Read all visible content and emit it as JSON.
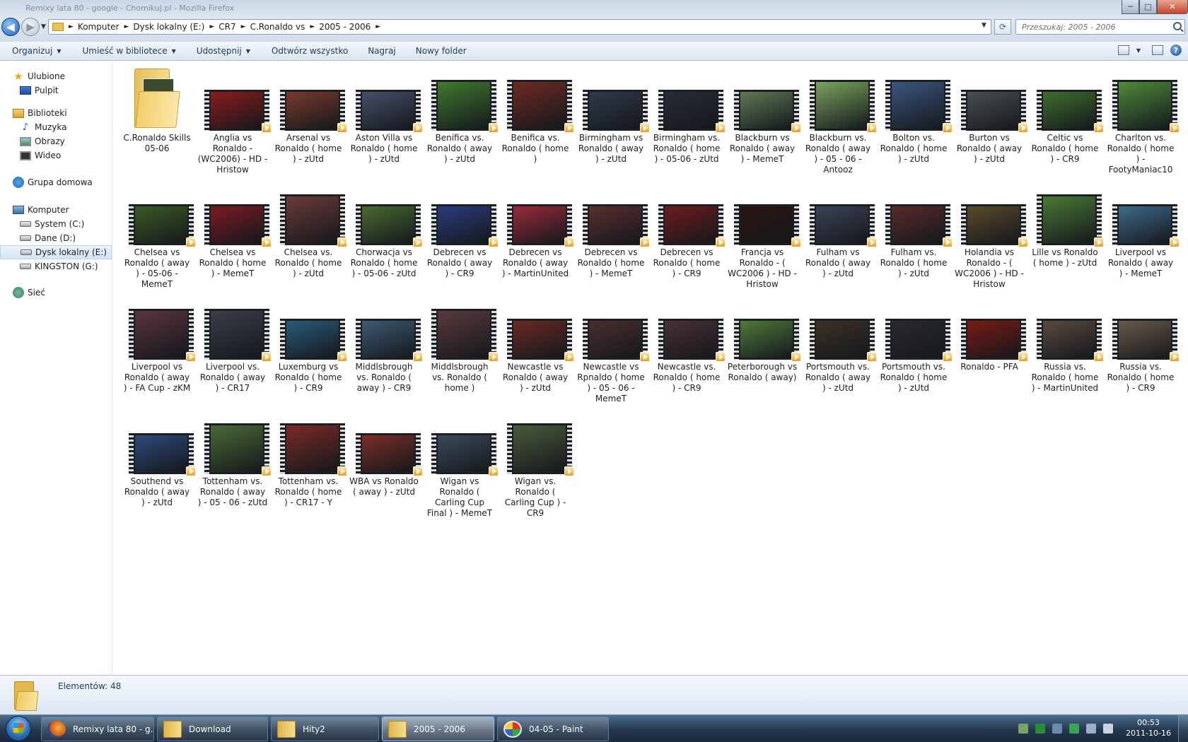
{
  "window": {
    "title_ghost": "Remixy lata 80 - google - Chomikuj.pl - Mozilla Firefox",
    "controls": {
      "minimize": "─",
      "maximize": "□",
      "close": "✕"
    }
  },
  "nav": {
    "back_icon": "◀",
    "forward_icon": "▶",
    "history_dropdown": "▼"
  },
  "address": {
    "crumbs": [
      "Komputer",
      "Dysk lokalny (E:)",
      "CR7",
      "C.Ronaldo vs",
      "2005 - 2006"
    ],
    "separator": "►",
    "dropdown": "▼",
    "refresh_icon": "⟳"
  },
  "search": {
    "placeholder": "Przeszukaj: 2005 - 2006"
  },
  "toolbar": {
    "items": [
      {
        "label": "Organizuj",
        "has_menu": true
      },
      {
        "label": "Umieść w bibliotece",
        "has_menu": true
      },
      {
        "label": "Udostępnij",
        "has_menu": true
      },
      {
        "label": "Odtwórz wszystko",
        "has_menu": false
      },
      {
        "label": "Nagraj",
        "has_menu": false
      },
      {
        "label": "Nowy folder",
        "has_menu": false
      }
    ],
    "caret": "▼",
    "view_caret": "▼",
    "help": "?"
  },
  "sidebar": {
    "groups": [
      {
        "label": "Ulubione",
        "icon": "star-icon",
        "children": [
          {
            "label": "Pulpit",
            "icon": "desktop-icon"
          }
        ]
      },
      {
        "label": "Biblioteki",
        "icon": "library-icon",
        "children": [
          {
            "label": "Muzyka",
            "icon": "music-icon"
          },
          {
            "label": "Obrazy",
            "icon": "pictures-icon"
          },
          {
            "label": "Wideo",
            "icon": "video-icon"
          }
        ]
      },
      {
        "label": "Grupa domowa",
        "icon": "homegroup-icon",
        "children": []
      },
      {
        "label": "Komputer",
        "icon": "computer-icon",
        "children": [
          {
            "label": "System (C:)",
            "icon": "drive-icon"
          },
          {
            "label": "Dane (D:)",
            "icon": "drive-icon"
          },
          {
            "label": "Dysk lokalny (E:)",
            "icon": "drive-icon",
            "selected": true
          },
          {
            "label": "KINGSTON (G:)",
            "icon": "usb-drive-icon"
          }
        ]
      },
      {
        "label": "Sieć",
        "icon": "network-icon",
        "children": []
      }
    ],
    "star_glyph": "★",
    "music_glyph": "♪"
  },
  "files": [
    {
      "name": "C.Ronaldo Skills 05-06",
      "type": "folder"
    },
    {
      "name": "Anglia vs Ronaldo - (WC2006) - HD - Hristow",
      "type": "video",
      "color": "#8a1c1c"
    },
    {
      "name": "Arsenal vs Ronaldo ( home ) - zUtd",
      "type": "video",
      "color": "#7a3a2c"
    },
    {
      "name": "Aston Villa vs Ronaldo ( home ) - zUtd",
      "type": "video",
      "color": "#45506a"
    },
    {
      "name": "Benifica vs. Ronaldo ( away ) - zUtd",
      "type": "video",
      "color": "#3f7a2e",
      "tall": true
    },
    {
      "name": "Benifica vs. Ronaldo ( home )",
      "type": "video",
      "color": "#6e2a22",
      "tall": true
    },
    {
      "name": "Birmingham vs Ronaldo ( away ) - zUtd",
      "type": "video",
      "color": "#2f3a4a"
    },
    {
      "name": "Birmingham vs. Ronaldo ( home ) - 05-06 - zUtd",
      "type": "video",
      "color": "#262d38"
    },
    {
      "name": "Blackburn vs Ronaldo ( away ) -  MemeT",
      "type": "video",
      "color": "#5d7a52"
    },
    {
      "name": "Blackburn vs. Ronaldo ( away ) - 05 - 06 - Antooz",
      "type": "video",
      "color": "#7aa35e",
      "tall": true
    },
    {
      "name": "Bolton vs. Ronaldo ( home ) - zUtd",
      "type": "video",
      "color": "#3a567e",
      "tall": true
    },
    {
      "name": "Burton vs Ronaldo ( away ) - zUtd",
      "type": "video",
      "color": "#4a4e52"
    },
    {
      "name": "Celtic vs Ronaldo ( home  ) - CR9",
      "type": "video",
      "color": "#3e6e2c"
    },
    {
      "name": "Charlton vs. Ronaldo ( home ) - FootyManiac10",
      "type": "video",
      "color": "#4f8a3a",
      "tall": true
    },
    {
      "name": "Chelsea vs Ronaldo ( away ) - 05-06 - MemeT",
      "type": "video",
      "color": "#3c5a26"
    },
    {
      "name": "Chelsea vs Ronaldo ( home ) - MemeT",
      "type": "video",
      "color": "#7a1a22"
    },
    {
      "name": "Chelsea vs. Ronaldo ( home ) - zUtd",
      "type": "video",
      "color": "#6b3a38",
      "tall": true
    },
    {
      "name": "Chorwacja vs Ronaldo ( home ) - 05-06 - zUtd",
      "type": "video",
      "color": "#4a6a30"
    },
    {
      "name": "Debrecen vs Ronaldo ( away ) - CR9",
      "type": "video",
      "color": "#2a3c7e"
    },
    {
      "name": "Debrecen vs Ronaldo ( away ) - MartinUnited",
      "type": "video",
      "color": "#9a2a3a"
    },
    {
      "name": "Debrecen vs Ronaldo ( home )  - MemeT",
      "type": "video",
      "color": "#5a2e2e"
    },
    {
      "name": "Debrecen vs Ronaldo ( home ) - CR9",
      "type": "video",
      "color": "#6e1c1c"
    },
    {
      "name": "Francja vs Ronaldo - ( WC2006 ) - HD - Hristow",
      "type": "video",
      "color": "#2a1410"
    },
    {
      "name": "Fulham vs Ronaldo ( away ) - zUtd",
      "type": "video",
      "color": "#3a4256"
    },
    {
      "name": "Fulham vs. Ronaldo  ( home ) - zUtd",
      "type": "video",
      "color": "#5a2a2a"
    },
    {
      "name": "Holandia vs Ronaldo - ( WC2006 ) - HD - Hristow",
      "type": "video",
      "color": "#5a4a2a"
    },
    {
      "name": "Lille vs Ronaldo ( home ) - zUtd",
      "type": "video",
      "color": "#4a7a36",
      "tall": true
    },
    {
      "name": "Liverpool vs Ronaldo ( away )  - MemeT",
      "type": "video",
      "color": "#3e6a8a"
    },
    {
      "name": "Liverpool vs Ronaldo ( away ) - FA Cup - zKM",
      "type": "video",
      "color": "#5a3440",
      "tall": true
    },
    {
      "name": "Liverpool vs. Ronaldo ( away ) - CR17",
      "type": "video",
      "color": "#3a3e4a",
      "tall": true
    },
    {
      "name": "Luxemburg vs Ronaldo ( home ) - CR9",
      "type": "video",
      "color": "#2a5a7a"
    },
    {
      "name": "Middlsbrough vs. Ronaldo ( away ) - CR9",
      "type": "video",
      "color": "#3e5a72"
    },
    {
      "name": "Middlsbrough vs. Ronaldo ( home )",
      "type": "video",
      "color": "#5a3a3e",
      "tall": true
    },
    {
      "name": "Newcastle vs Ronaldo ( away ) - zUtd",
      "type": "video",
      "color": "#6a2a22"
    },
    {
      "name": "Newcastle vs Rpnaldo ( home ) - 05 - 06 - MemeT",
      "type": "video",
      "color": "#4a2e2e"
    },
    {
      "name": "Newcastle vs. Ronaldo ( home ) - CR9",
      "type": "video",
      "color": "#4a3034"
    },
    {
      "name": "Peterborough vs Ronaldo ( away)",
      "type": "video",
      "color": "#4e7a3a"
    },
    {
      "name": "Portsmouth vs. Ronaldo ( away ) - zUtd",
      "type": "video",
      "color": "#3a3226"
    },
    {
      "name": "Portsmouth vs. Ronaldo ( home ) - zUtd",
      "type": "video",
      "color": "#2a2a2e"
    },
    {
      "name": "Ronaldo - PFA",
      "type": "video",
      "color": "#7a1a14"
    },
    {
      "name": "Russia vs. Ronaldo ( home )  - MartinUnited",
      "type": "video",
      "color": "#5a4a3e"
    },
    {
      "name": "Russia vs. Ronaldo ( home ) - CR9",
      "type": "video",
      "color": "#6a5a4a"
    },
    {
      "name": "Southend vs Ronaldo ( away ) - zUtd",
      "type": "video",
      "color": "#2e4a7a"
    },
    {
      "name": "Tottenham vs. Ronaldo ( away ) - 05 - 06 - zUtd",
      "type": "video",
      "color": "#4a6a36",
      "tall": true
    },
    {
      "name": "Tottenham vs. Ronaldo ( home ) - CR17 - Y",
      "type": "video",
      "color": "#7a2a26",
      "tall": true
    },
    {
      "name": "WBA vs Ronaldo ( away ) - zUtd",
      "type": "video",
      "color": "#7a2e26"
    },
    {
      "name": "Wigan vs Ronaldo ( Carling Cup Final ) - MemeT",
      "type": "video",
      "color": "#3a4a5a"
    },
    {
      "name": "Wigan vs. Ronaldo ( Carling Cup  ) - CR9",
      "type": "video",
      "color": "#4a5a3a",
      "tall": true
    }
  ],
  "status": {
    "count_text": "Elementów: 48"
  },
  "taskbar": {
    "tasks": [
      {
        "label": "Remixy lata 80 - g...",
        "icon": "firefox-icon",
        "active": false
      },
      {
        "label": "Download",
        "icon": "folder-icon",
        "active": false
      },
      {
        "label": "Hity2",
        "icon": "folder-icon",
        "active": false
      },
      {
        "label": "2005 - 2006",
        "icon": "folder-icon",
        "active": true
      },
      {
        "label": "04-05 - Paint",
        "icon": "paint-icon",
        "active": false
      }
    ],
    "tray_colors": [
      "#7aa36a",
      "#2d8a3a",
      "#6a8ab0",
      "#3aa35a",
      "#9ab0c8",
      "#c8d4e0"
    ],
    "clock_time": "00:53",
    "clock_date": "2011-10-16"
  }
}
